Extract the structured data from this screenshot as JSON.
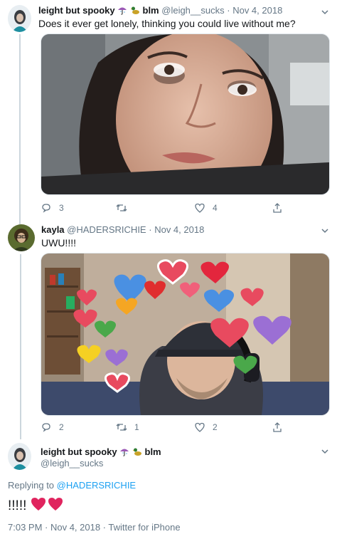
{
  "tweets": [
    {
      "name": "leight but spooky",
      "suffix": "blm",
      "handle": "@leigh__sucks",
      "dot": "·",
      "date": "Nov 4, 2018",
      "text": "Does it ever get lonely, thinking you could live without me?",
      "replies": "3",
      "retweets": "",
      "likes": "4"
    },
    {
      "name": "kayla",
      "handle": "@HADERSRICHIE",
      "dot": "·",
      "date": "Nov 4, 2018",
      "text": "UWU!!!!",
      "replies": "2",
      "retweets": "1",
      "likes": "2"
    }
  ],
  "focused": {
    "name": "leight but spooky",
    "suffix": "blm",
    "handle": "@leigh__sucks",
    "replying_prefix": "Replying to",
    "replying_to": "@HADERSRICHIE",
    "text": "!!!!!",
    "timestamp": "7:03 PM · Nov 4, 2018 · Twitter for iPhone"
  },
  "colors": {
    "link": "#1da1f2",
    "muted": "#657786",
    "heart": "#e0245e"
  },
  "icons": [
    "reply-icon",
    "retweet-icon",
    "like-icon",
    "share-icon",
    "chevron-down-icon",
    "umbrella-emoji",
    "duck-emoji",
    "heart-emoji"
  ]
}
